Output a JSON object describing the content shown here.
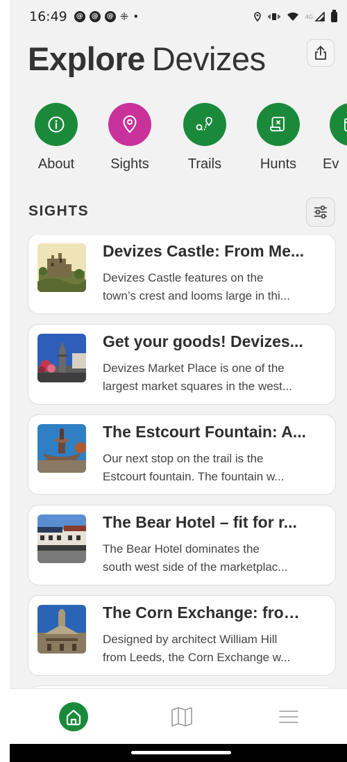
{
  "status_bar": {
    "time": "16:49",
    "network": "4G"
  },
  "header": {
    "title_bold": "Explore",
    "title_light": "Devizes"
  },
  "categories": [
    {
      "label": "About",
      "icon": "info-icon",
      "color": "#1a8a3a"
    },
    {
      "label": "Sights",
      "icon": "location-pin-icon",
      "color": "#c8329a"
    },
    {
      "label": "Trails",
      "icon": "route-icon",
      "color": "#1a8a3a"
    },
    {
      "label": "Hunts",
      "icon": "scroll-map-icon",
      "color": "#1a8a3a"
    },
    {
      "label": "Ev",
      "icon": "calendar-icon",
      "color": "#1a8a3a"
    }
  ],
  "section": {
    "title": "SIGHTS"
  },
  "sights": [
    {
      "title": "Devizes Castle: From Me...",
      "desc_line1": "Devizes Castle features on the",
      "desc_line2": "town’s crest and looms large in thi...",
      "thumb": "castle"
    },
    {
      "title": "Get your goods! Devizes...",
      "desc_line1": "Devizes Market Place is one of the",
      "desc_line2": "largest market squares in the west...",
      "thumb": "market"
    },
    {
      "title": "The Estcourt Fountain: A...",
      "desc_line1": "Our next stop on the trail is the",
      "desc_line2": "Estcourt fountain. The fountain w...",
      "thumb": "fountain"
    },
    {
      "title": "The Bear Hotel – fit for r...",
      "desc_line1": "The Bear Hotel dominates the",
      "desc_line2": "south west side of the marketplac...",
      "thumb": "hotel"
    },
    {
      "title": "The Corn Exchange: from...",
      "desc_line1": "Designed by architect William Hill",
      "desc_line2": "from Leeds, the Corn Exchange w...",
      "thumb": "corn-exchange"
    }
  ],
  "colors": {
    "accent_green": "#1a8a3a",
    "accent_pink": "#c8329a"
  },
  "bottom_nav": [
    {
      "icon": "home-icon",
      "active": true
    },
    {
      "icon": "map-icon",
      "active": false
    },
    {
      "icon": "menu-icon",
      "active": false
    }
  ]
}
